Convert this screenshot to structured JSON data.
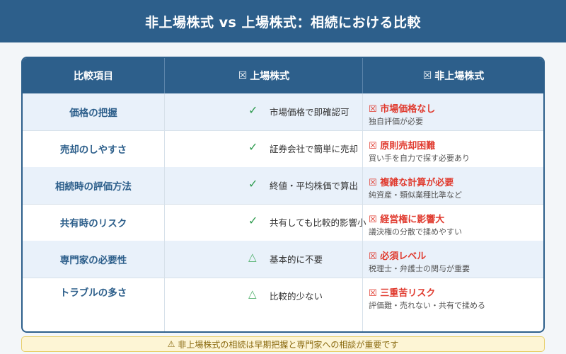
{
  "title": "非上場株式 vs 上場株式：相続における比較",
  "table": {
    "headers": {
      "item": "比較項目",
      "listed": "上場株式",
      "listed_icon": "☒",
      "unlisted": "非上場株式",
      "unlisted_icon": "☒"
    },
    "rows": [
      {
        "item": "価格の把握",
        "listed_mark": "✓",
        "listed_text": "市場価格で即確認可",
        "unlisted_icon": "☒",
        "unlisted_head": "市場価格なし",
        "unlisted_sub": "独自評価が必要"
      },
      {
        "item": "売却のしやすさ",
        "listed_mark": "✓",
        "listed_text": "証券会社で簡単に売却",
        "unlisted_icon": "☒",
        "unlisted_head": "原則売却困難",
        "unlisted_sub": "買い手を自力で探す必要あり"
      },
      {
        "item": "相続時の評価方法",
        "listed_mark": "✓",
        "listed_text": "終値・平均株価で算出",
        "unlisted_icon": "☒",
        "unlisted_head": "複雑な計算が必要",
        "unlisted_sub": "純資産・類似業種比準など"
      },
      {
        "item": "共有時のリスク",
        "listed_mark": "✓",
        "listed_text": "共有しても比較的影響小",
        "unlisted_icon": "☒",
        "unlisted_head": "経営権に影響大",
        "unlisted_sub": "議決権の分散で揉めやすい"
      },
      {
        "item": "専門家の必要性",
        "listed_mark": "△",
        "listed_text": "基本的に不要",
        "unlisted_icon": "☒",
        "unlisted_head": "必須レベル",
        "unlisted_sub": "税理士・弁護士の関与が重要"
      },
      {
        "item": "トラブルの多さ",
        "listed_mark": "△",
        "listed_text": "比較的少ない",
        "unlisted_icon": "☒",
        "unlisted_head": "三重苦リスク",
        "unlisted_sub": "評価難・売れない・共有で揉める"
      }
    ]
  },
  "footer": {
    "icon": "⚠",
    "text": "非上場株式の相続は早期把握と専門家への相談が重要です"
  },
  "colors": {
    "primary": "#2d5f8b",
    "warning_red": "#e03b2f",
    "check_green": "#2e9b4e",
    "note_bg": "#fdf5d5"
  }
}
